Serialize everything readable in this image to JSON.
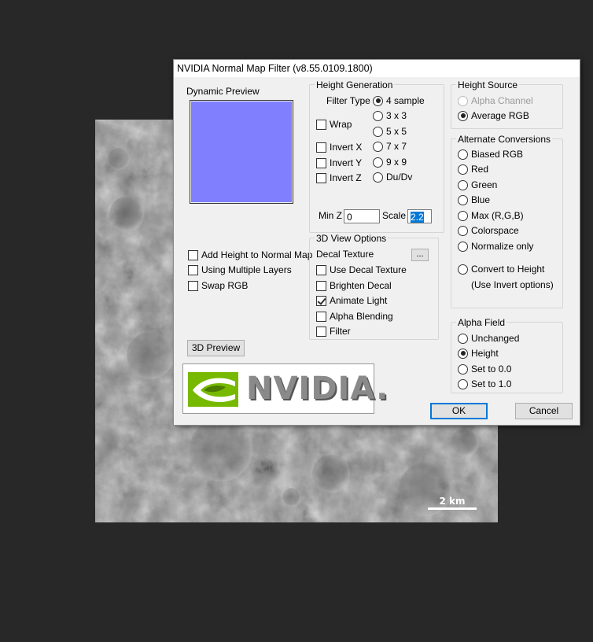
{
  "background": {
    "scale_label": "2 km"
  },
  "dialog": {
    "title": "NVIDIA Normal Map Filter (v8.55.0109.1800)",
    "dynamic_preview_label": "Dynamic Preview",
    "preview_color": "#8080ff",
    "left_options": [
      {
        "label": "Add Height to Normal Map",
        "checked": false
      },
      {
        "label": "Using Multiple Layers",
        "checked": false
      },
      {
        "label": "Swap RGB",
        "checked": false
      }
    ],
    "preview_3d_button": "3D Preview",
    "logo_text": "NVIDIA.",
    "height_generation": {
      "label": "Height Generation",
      "filter_type_label": "Filter Type",
      "filter_types": [
        {
          "label": "4 sample",
          "checked": true
        },
        {
          "label": "3 x 3",
          "checked": false
        },
        {
          "label": "5 x 5",
          "checked": false
        },
        {
          "label": "7 x 7",
          "checked": false
        },
        {
          "label": "9 x 9",
          "checked": false
        },
        {
          "label": "Du/Dv",
          "checked": false
        }
      ],
      "wrap_label": "Wrap",
      "invert_x_label": "Invert X",
      "invert_y_label": "Invert Y",
      "invert_z_label": "Invert Z",
      "min_z_label": "Min Z",
      "min_z_value": "0",
      "scale_label": "Scale",
      "scale_value": "2.2"
    },
    "view_options": {
      "label": "3D View Options",
      "decal_texture_label": "Decal Texture",
      "browse_label": "...",
      "options": [
        {
          "label": "Use Decal Texture",
          "checked": false
        },
        {
          "label": "Brighten Decal",
          "checked": false
        },
        {
          "label": "Animate Light",
          "checked": true
        },
        {
          "label": "Alpha Blending",
          "checked": false
        },
        {
          "label": "Filter",
          "checked": false
        }
      ]
    },
    "height_source": {
      "label": "Height Source",
      "options": [
        {
          "label": "Alpha Channel",
          "checked": false,
          "disabled": true
        },
        {
          "label": "Average RGB",
          "checked": true,
          "disabled": false
        }
      ]
    },
    "alternate_conversions": {
      "label": "Alternate Conversions",
      "options": [
        {
          "label": "Biased RGB",
          "checked": false
        },
        {
          "label": "Red",
          "checked": false
        },
        {
          "label": "Green",
          "checked": false
        },
        {
          "label": "Blue",
          "checked": false
        },
        {
          "label": "Max (R,G,B)",
          "checked": false
        },
        {
          "label": "Colorspace",
          "checked": false
        },
        {
          "label": "Normalize only",
          "checked": false
        },
        {
          "label": "Convert to Height",
          "checked": false
        }
      ],
      "note": "(Use Invert options)"
    },
    "alpha_field": {
      "label": "Alpha Field",
      "options": [
        {
          "label": "Unchanged",
          "checked": false
        },
        {
          "label": "Height",
          "checked": true
        },
        {
          "label": "Set to 0.0",
          "checked": false
        },
        {
          "label": "Set to 1.0",
          "checked": false
        }
      ]
    },
    "ok_label": "OK",
    "cancel_label": "Cancel"
  }
}
